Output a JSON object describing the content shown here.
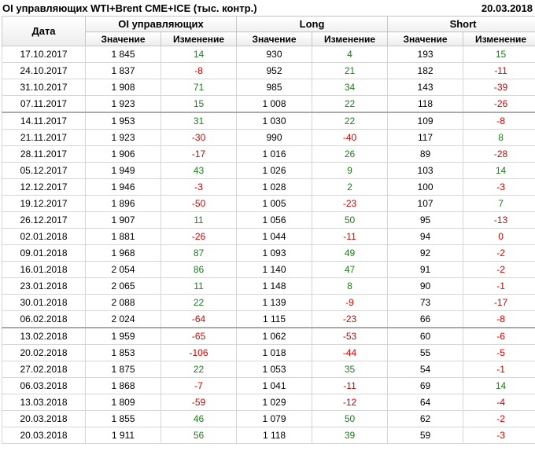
{
  "header": {
    "title": "OI управляющих WTI+Brent CME+ICE (тыс. контр.)",
    "date": "20.03.2018"
  },
  "columns": {
    "date": "Дата",
    "groups": [
      "OI управляющих",
      "Long",
      "Short"
    ],
    "value": "Значение",
    "change": "Изменение"
  },
  "rows": [
    {
      "date": "17.10.2017",
      "oi_v": "1 845",
      "oi_c": "14",
      "long_v": "930",
      "long_c": "4",
      "short_v": "193",
      "short_c": "15"
    },
    {
      "date": "24.10.2017",
      "oi_v": "1 837",
      "oi_c": "-8",
      "long_v": "952",
      "long_c": "21",
      "short_v": "182",
      "short_c": "-11"
    },
    {
      "date": "31.10.2017",
      "oi_v": "1 908",
      "oi_c": "71",
      "long_v": "985",
      "long_c": "34",
      "short_v": "143",
      "short_c": "-39"
    },
    {
      "date": "07.11.2017",
      "oi_v": "1 923",
      "oi_c": "15",
      "long_v": "1 008",
      "long_c": "22",
      "short_v": "118",
      "short_c": "-26"
    },
    {
      "date": "14.11.2017",
      "oi_v": "1 953",
      "oi_c": "31",
      "long_v": "1 030",
      "long_c": "22",
      "short_v": "109",
      "short_c": "-8"
    },
    {
      "date": "21.11.2017",
      "oi_v": "1 923",
      "oi_c": "-30",
      "long_v": "990",
      "long_c": "-40",
      "short_v": "117",
      "short_c": "8"
    },
    {
      "date": "28.11.2017",
      "oi_v": "1 906",
      "oi_c": "-17",
      "long_v": "1 016",
      "long_c": "26",
      "short_v": "89",
      "short_c": "-28"
    },
    {
      "date": "05.12.2017",
      "oi_v": "1 949",
      "oi_c": "43",
      "long_v": "1 026",
      "long_c": "9",
      "short_v": "103",
      "short_c": "14"
    },
    {
      "date": "12.12.2017",
      "oi_v": "1 946",
      "oi_c": "-3",
      "long_v": "1 028",
      "long_c": "2",
      "short_v": "100",
      "short_c": "-3"
    },
    {
      "date": "19.12.2017",
      "oi_v": "1 896",
      "oi_c": "-50",
      "long_v": "1 005",
      "long_c": "-23",
      "short_v": "107",
      "short_c": "7"
    },
    {
      "date": "26.12.2017",
      "oi_v": "1 907",
      "oi_c": "11",
      "long_v": "1 056",
      "long_c": "50",
      "short_v": "95",
      "short_c": "-13"
    },
    {
      "date": "02.01.2018",
      "oi_v": "1 881",
      "oi_c": "-26",
      "long_v": "1 044",
      "long_c": "-11",
      "short_v": "94",
      "short_c": "0"
    },
    {
      "date": "09.01.2018",
      "oi_v": "1 968",
      "oi_c": "87",
      "long_v": "1 093",
      "long_c": "49",
      "short_v": "92",
      "short_c": "-2"
    },
    {
      "date": "16.01.2018",
      "oi_v": "2 054",
      "oi_c": "86",
      "long_v": "1 140",
      "long_c": "47",
      "short_v": "91",
      "short_c": "-2"
    },
    {
      "date": "23.01.2018",
      "oi_v": "2 065",
      "oi_c": "11",
      "long_v": "1 148",
      "long_c": "8",
      "short_v": "90",
      "short_c": "-1"
    },
    {
      "date": "30.01.2018",
      "oi_v": "2 088",
      "oi_c": "22",
      "long_v": "1 139",
      "long_c": "-9",
      "short_v": "73",
      "short_c": "-17"
    },
    {
      "date": "06.02.2018",
      "oi_v": "2 024",
      "oi_c": "-64",
      "long_v": "1 115",
      "long_c": "-23",
      "short_v": "66",
      "short_c": "-8"
    },
    {
      "date": "13.02.2018",
      "oi_v": "1 959",
      "oi_c": "-65",
      "long_v": "1 062",
      "long_c": "-53",
      "short_v": "60",
      "short_c": "-6"
    },
    {
      "date": "20.02.2018",
      "oi_v": "1 853",
      "oi_c": "-106",
      "long_v": "1 018",
      "long_c": "-44",
      "short_v": "55",
      "short_c": "-5"
    },
    {
      "date": "27.02.2018",
      "oi_v": "1 875",
      "oi_c": "22",
      "long_v": "1 053",
      "long_c": "35",
      "short_v": "54",
      "short_c": "-1"
    },
    {
      "date": "06.03.2018",
      "oi_v": "1 868",
      "oi_c": "-7",
      "long_v": "1 041",
      "long_c": "-11",
      "short_v": "69",
      "short_c": "14"
    },
    {
      "date": "13.03.2018",
      "oi_v": "1 809",
      "oi_c": "-59",
      "long_v": "1 029",
      "long_c": "-12",
      "short_v": "64",
      "short_c": "-4"
    },
    {
      "date": "20.03.2018",
      "oi_v": "1 855",
      "oi_c": "46",
      "long_v": "1 079",
      "long_c": "50",
      "short_v": "62",
      "short_c": "-2"
    },
    {
      "date": "20.03.2018",
      "oi_v": "1 911",
      "oi_c": "56",
      "long_v": "1 118",
      "long_c": "39",
      "short_v": "59",
      "short_c": "-3"
    }
  ],
  "colors": {
    "positive": "#1a7f1a",
    "negative": "#d00000"
  }
}
